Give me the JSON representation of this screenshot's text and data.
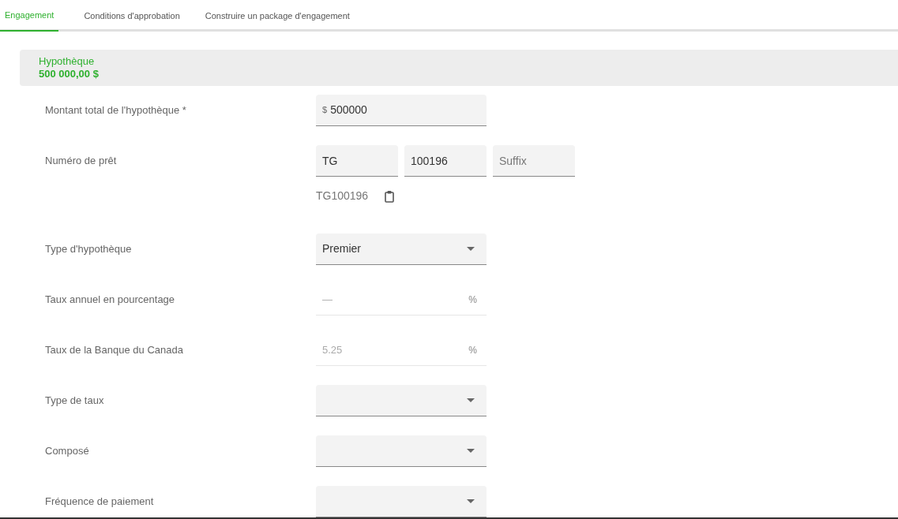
{
  "tabs": [
    {
      "label": "Engagement",
      "selected": true
    },
    {
      "label": "Conditions d'approbation",
      "selected": false
    },
    {
      "label": "Construire un package d'engagement",
      "selected": false
    }
  ],
  "section": {
    "title": "Hypothèque",
    "amount": "500 000,00 $"
  },
  "rows": [
    {
      "kind": "money",
      "label": "Montant total de l'hypothèque *",
      "prefix": "$",
      "value": "500000"
    },
    {
      "kind": "loan",
      "label": "Numéro de prêt",
      "parts": [
        {
          "value": "TG"
        },
        {
          "value": "100196"
        },
        {
          "placeholder": "Suffix"
        }
      ],
      "combined": "TG100196"
    },
    {
      "kind": "select",
      "label": "Type d'hypothèque",
      "value": "Premier"
    },
    {
      "kind": "readonly",
      "label": "Taux annuel en pourcentage",
      "value": "—",
      "suffix": "%"
    },
    {
      "kind": "readonly",
      "label": "Taux de la Banque du Canada",
      "value": "5.25",
      "suffix": "%"
    },
    {
      "kind": "select",
      "label": "Type de taux"
    },
    {
      "kind": "select",
      "label": "Composé"
    },
    {
      "kind": "select",
      "label": "Fréquence de paiement"
    }
  ]
}
